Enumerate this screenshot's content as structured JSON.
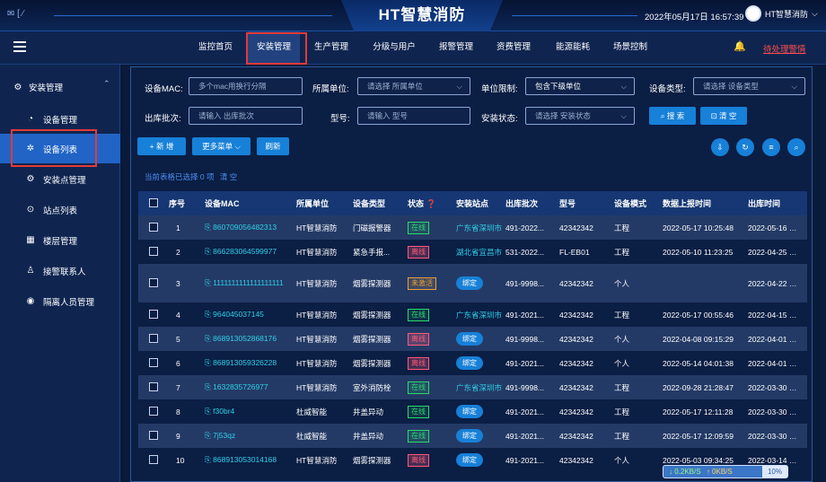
{
  "header": {
    "top_left": "✉ [ ⁄",
    "title": "HT智慧消防",
    "datetime": "2022年05月17日 16:57:39",
    "user": "HT智慧消防",
    "user_arrow": "⌵"
  },
  "nav": {
    "items": [
      "监控首页",
      "安装管理",
      "生产管理",
      "分级与用户",
      "报警管理",
      "资费管理",
      "能源能耗",
      "场景控制"
    ],
    "active": "安装管理",
    "alarm": "待处理警情"
  },
  "sidebar": {
    "group": "安装管理",
    "items": [
      "设备管理",
      "设备列表",
      "安装点管理",
      "站点列表",
      "楼层管理",
      "接警联系人",
      "隔离人员管理"
    ],
    "active": "设备列表"
  },
  "filters": {
    "mac_label": "设备MAC:",
    "mac_placeholder": "多个mac用换行分隔",
    "unit_label": "所属单位:",
    "unit_placeholder": "请选择 所属单位",
    "limit_label": "单位限制:",
    "limit_value": "包含下级单位",
    "type_label": "设备类型:",
    "type_placeholder": "请选择 设备类型",
    "batch_label": "出库批次:",
    "batch_placeholder": "请输入 出库批次",
    "model_label": "型号:",
    "model_placeholder": "请输入 型号",
    "status_label": "安装状态:",
    "status_placeholder": "请选择 安装状态",
    "search_btn": "⌕ 搜 索",
    "clear_btn": "⊡ 清 空"
  },
  "toolbar": {
    "add": "+ 新 增",
    "more": "更多菜单 ⌵",
    "refresh": "刷新",
    "selected_text": "当前表格已选择",
    "selected_count": "0",
    "selected_unit": "项",
    "clear": "清 空"
  },
  "table": {
    "columns": [
      "序号",
      "设备MAC",
      "所属单位",
      "设备类型",
      "状态 ❓",
      "安装站点",
      "出库批次",
      "型号",
      "设备模式",
      "数据上报时间",
      "出库时间"
    ],
    "rows": [
      {
        "no": "1",
        "mac": "860709056482313",
        "unit": "HT智慧消防",
        "type": "门磁报警器",
        "status": "在线",
        "site": "广东省深圳市",
        "batch": "491-2022...",
        "model": "42342342",
        "mode": "工程",
        "report": "2022-05-17 10:25:48",
        "out": "2022-05-16 1..."
      },
      {
        "no": "2",
        "mac": "866283064599977",
        "unit": "HT智慧消防",
        "type": "紧急手报...",
        "status": "离线",
        "site": "湖北省宜昌市",
        "batch": "531-2022...",
        "model": "FL-EB01",
        "mode": "工程",
        "report": "2022-05-10 11:23:25",
        "out": "2022-04-25 1..."
      },
      {
        "no": "3",
        "mac": "1111111111111111111",
        "unit": "HT智慧消防",
        "type": "烟雾探测器",
        "status": "未激活",
        "site": "绑定",
        "batch": "491-9998...",
        "model": "42342342",
        "mode": "个人",
        "report": "",
        "out": "2022-04-22 1..."
      },
      {
        "no": "4",
        "mac": "964045037145",
        "unit": "HT智慧消防",
        "type": "烟雾探测器",
        "status": "在线",
        "site": "广东省深圳市",
        "batch": "491-2021...",
        "model": "42342342",
        "mode": "工程",
        "report": "2022-05-17 00:55:46",
        "out": "2022-04-15 1..."
      },
      {
        "no": "5",
        "mac": "868913052868176",
        "unit": "HT智慧消防",
        "type": "烟雾探测器",
        "status": "离线",
        "site": "绑定",
        "batch": "491-9998...",
        "model": "42342342",
        "mode": "个人",
        "report": "2022-04-08 09:15:29",
        "out": "2022-04-01 1..."
      },
      {
        "no": "6",
        "mac": "868913059326228",
        "unit": "HT智慧消防",
        "type": "烟雾探测器",
        "status": "离线",
        "site": "绑定",
        "batch": "491-2021...",
        "model": "42342342",
        "mode": "个人",
        "report": "2022-05-14 04:01:38",
        "out": "2022-04-01 1..."
      },
      {
        "no": "7",
        "mac": "1632835726977",
        "unit": "HT智慧消防",
        "type": "室外消防栓",
        "status": "在线",
        "site": "广东省深圳市",
        "batch": "491-9998...",
        "model": "42342342",
        "mode": "工程",
        "report": "2022-09-28 21:28:47",
        "out": "2022-03-30 1..."
      },
      {
        "no": "8",
        "mac": "f30br4",
        "unit": "杜威智能",
        "type": "井盖异动",
        "status": "在线",
        "site": "绑定",
        "batch": "491-2021...",
        "model": "42342342",
        "mode": "工程",
        "report": "2022-05-17 12:11:28",
        "out": "2022-03-30 0..."
      },
      {
        "no": "9",
        "mac": "7j53qz",
        "unit": "杜威智能",
        "type": "井盖异动",
        "status": "在线",
        "site": "绑定",
        "batch": "491-2021...",
        "model": "42342342",
        "mode": "工程",
        "report": "2022-05-17 12:09:59",
        "out": "2022-03-30 0..."
      },
      {
        "no": "10",
        "mac": "868913053014168",
        "unit": "HT智慧消防",
        "type": "烟雾探测器",
        "status": "离线",
        "site": "绑定",
        "batch": "491-2021...",
        "model": "42342342",
        "mode": "个人",
        "report": "2022-05-03 09:34:25",
        "out": "2022-03-14 2..."
      }
    ]
  },
  "netspeed": {
    "down": "↓ 0.2KB/S",
    "up": "↑ 0KB/S",
    "pct": "10%"
  },
  "colors": {
    "online": "#2bd96b",
    "offline": "#ff5a7a",
    "inactive": "#e8a13a",
    "accent": "#1780d8",
    "highlight": "#e23a3a"
  }
}
